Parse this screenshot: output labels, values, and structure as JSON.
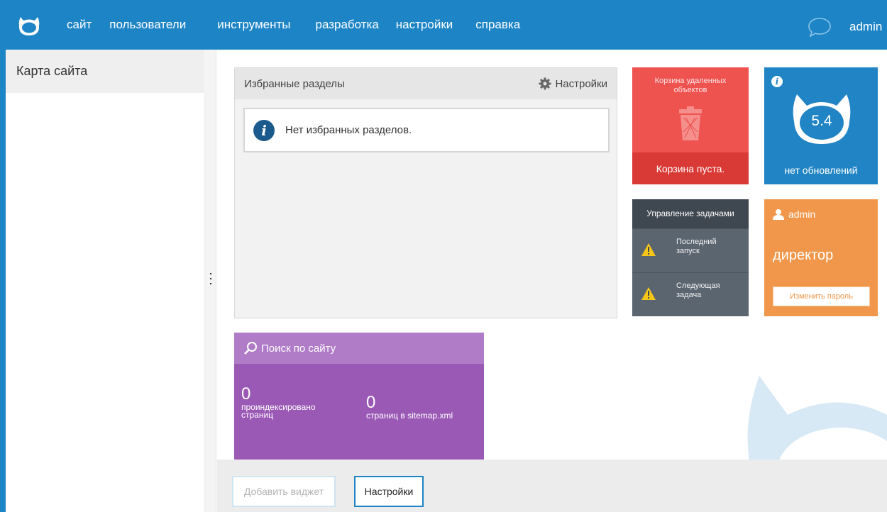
{
  "nav": {
    "items": [
      "сайт",
      "пользователи",
      "инструменты",
      "разработка",
      "настройки",
      "справка"
    ],
    "user": "admin"
  },
  "sidebar": {
    "title": "Карта сайта"
  },
  "favorites": {
    "title": "Избранные разделы",
    "settings_label": "Настройки",
    "empty_message": "Нет избранных разделов."
  },
  "trash": {
    "title": "Корзина удаленных объектов",
    "status": "Корзина пуста."
  },
  "updates": {
    "version": "5.4",
    "status": "нет обновлений"
  },
  "tasks": {
    "title": "Управление задачами",
    "rows": [
      {
        "label": "Последний запуск",
        "line1": "Последний",
        "line2": "запуск"
      },
      {
        "label": "Следующая задача",
        "line1": "Следующая",
        "line2": "задача"
      }
    ]
  },
  "admin_widget": {
    "username": "admin",
    "role": "директор",
    "change_password": "Изменить пароль"
  },
  "search": {
    "title": "Поиск по сайту",
    "indexed_count": "0",
    "indexed_label_1": "проиндексировано",
    "indexed_label_2": "страниц",
    "sitemap_count": "0",
    "sitemap_label": "страниц в sitemap.xml"
  },
  "footer": {
    "add_widget": "Добавить виджет",
    "settings": "Настройки"
  },
  "colors": {
    "topbar": "#1d84c6",
    "trash": "#ef5350",
    "updates": "#2185c5",
    "tasks": "#5b6570",
    "admin": "#f0974b",
    "search": "#9b59b6"
  }
}
